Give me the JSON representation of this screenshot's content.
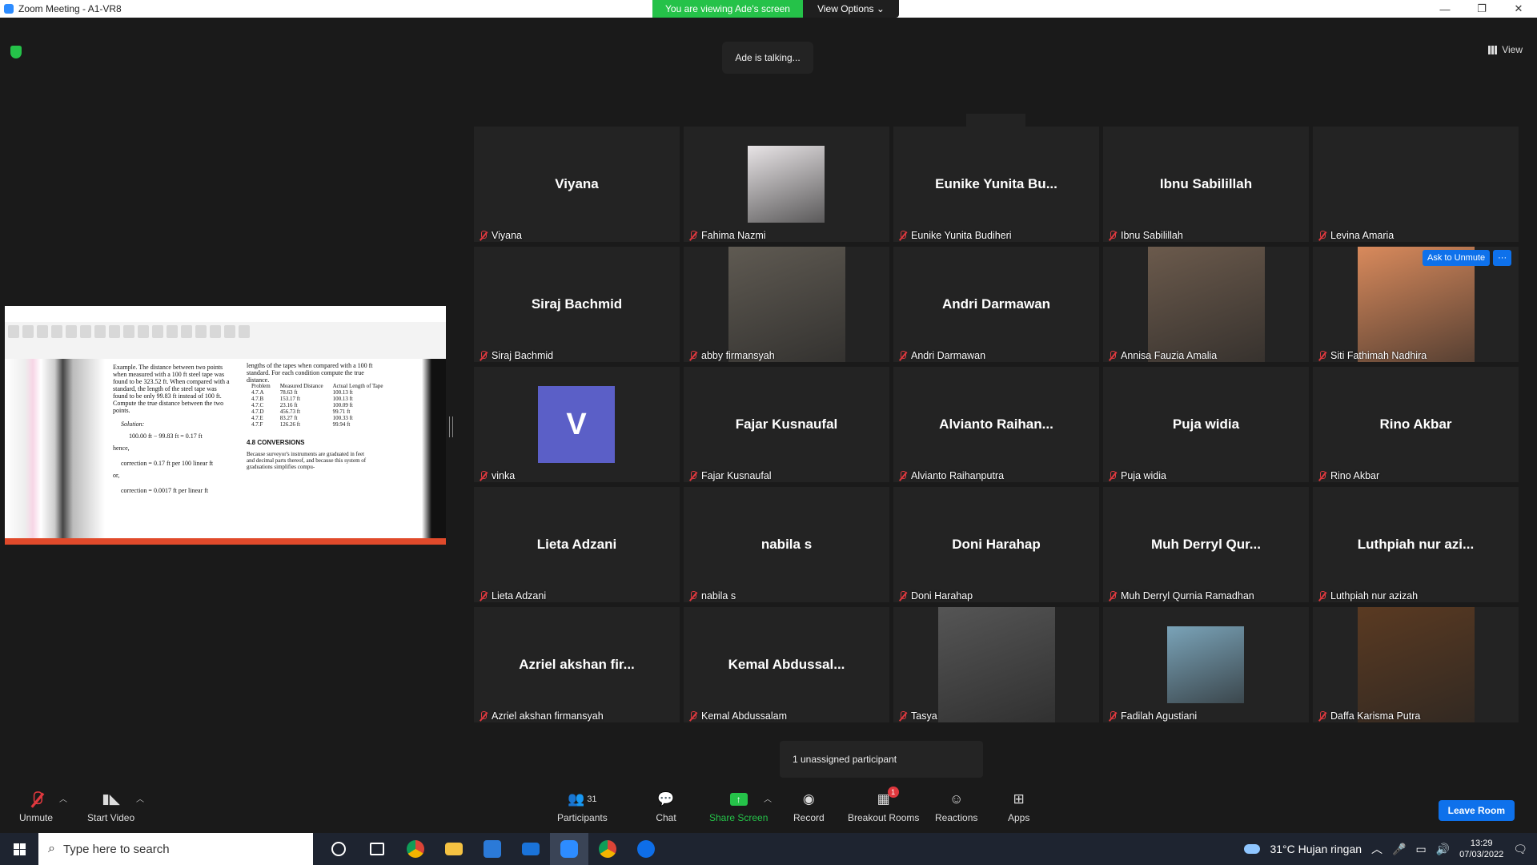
{
  "window": {
    "title": "Zoom Meeting - A1-VR8",
    "minimize": "—",
    "maximize": "❐",
    "close": "✕"
  },
  "banner": {
    "viewing": "You are viewing Ade's screen",
    "view_options": "View Options ⌄"
  },
  "talking": "Ade is talking...",
  "view_button": "View",
  "gallery_up": "︿",
  "shared_doc": {
    "para1": "Example. The distance between two points when measured with a 100 ft steel tape was found to be 323.52 ft. When compared with a standard, the length of the steel tape was found to be only 99.83 ft instead of 100 ft. Compute the true distance between the two points.",
    "solution": "Solution:",
    "calc": "100.00 ft − 99.83 ft = 0.17 ft",
    "hence": "hence,",
    "corr1": "correction = 0.17 ft per 100 linear ft",
    "or": "or,",
    "corr2": "correction = 0.0017 ft per linear ft",
    "right_text": "lengths of the tapes when compared with a 100 ft standard. For each condition compute the true distance.",
    "table_headers": [
      "Problem",
      "Measured Distance",
      "Actual Length of Tape"
    ],
    "table_rows": [
      [
        "4.7.A",
        "78.63 ft",
        "100.13 ft"
      ],
      [
        "4.7.B",
        "153.17 ft",
        "100.13 ft"
      ],
      [
        "4.7.C",
        "23.16 ft",
        "100.09 ft"
      ],
      [
        "4.7.D",
        "456.73 ft",
        "99.71 ft"
      ],
      [
        "4.7.E",
        "83.27 ft",
        "100.33 ft"
      ],
      [
        "4.7.F",
        "126.26 ft",
        "99.94 ft"
      ]
    ],
    "section": "4.8   CONVERSIONS",
    "section_text": "Because surveyor's instruments are graduated in feet and decimal parts thereof, and because this system of graduations simplifies compu-"
  },
  "participants": [
    {
      "display": "Viyana",
      "label": "Viyana",
      "pic": null
    },
    {
      "display": "",
      "label": "Fahima Nazmi",
      "pic": "small",
      "color": "#e8e4e6"
    },
    {
      "display": "Eunike Yunita Bu...",
      "label": "Eunike Yunita Budiheri",
      "pic": null
    },
    {
      "display": "Ibnu Sabilillah",
      "label": "Ibnu Sabilillah",
      "pic": null
    },
    {
      "display": "",
      "label": "Levina Amaria",
      "pic": null
    },
    {
      "display": "Siraj Bachmid",
      "label": "Siraj Bachmid",
      "pic": null
    },
    {
      "display": "",
      "label": "abby firmansyah",
      "pic": "full",
      "color": "#5f5a52"
    },
    {
      "display": "Andri Darmawan",
      "label": "Andri Darmawan",
      "pic": null
    },
    {
      "display": "",
      "label": "Annisa Fauzia Amalia",
      "pic": "full",
      "color": "#6b5a4c"
    },
    {
      "display": "",
      "label": "Siti Fathimah Nadhira",
      "pic": "full",
      "color": "#d98a5c"
    },
    {
      "display": "V",
      "label": "vinka",
      "pic": "letter",
      "color": "#5b5fc7"
    },
    {
      "display": "Fajar Kusnaufal",
      "label": "Fajar Kusnaufal",
      "pic": null
    },
    {
      "display": "Alvianto Raihan...",
      "label": "Alvianto Raihanputra",
      "pic": null
    },
    {
      "display": "Puja widia",
      "label": "Puja widia",
      "pic": null
    },
    {
      "display": "Rino Akbar",
      "label": "Rino Akbar",
      "pic": null
    },
    {
      "display": "Lieta Adzani",
      "label": "Lieta Adzani",
      "pic": null
    },
    {
      "display": "nabila s",
      "label": "nabila s",
      "pic": null
    },
    {
      "display": "Doni Harahap",
      "label": "Doni Harahap",
      "pic": null
    },
    {
      "display": "Muh Derryl Qur...",
      "label": "Muh Derryl Qurnia Ramadhan",
      "pic": null
    },
    {
      "display": "Luthpiah nur azi...",
      "label": "Luthpiah nur azizah",
      "pic": null
    },
    {
      "display": "Azriel akshan fir...",
      "label": "Azriel akshan firmansyah",
      "pic": null
    },
    {
      "display": "Kemal Abdussal...",
      "label": "Kemal Abdussalam",
      "pic": null
    },
    {
      "display": "",
      "label": "Tasya",
      "pic": "full",
      "color": "#555555"
    },
    {
      "display": "",
      "label": "Fadilah Agustiani",
      "pic": "small",
      "color": "#7aa3b8"
    },
    {
      "display": "",
      "label": "Daffa Karisma Putra",
      "pic": "full",
      "color": "#5a3a22"
    }
  ],
  "ask_unmute": {
    "label": "Ask to Unmute",
    "more": "···"
  },
  "unassigned": "1 unassigned participant",
  "toolbar": {
    "unmute": "Unmute",
    "start_video": "Start Video",
    "participants": "Participants",
    "participants_count": "31",
    "chat": "Chat",
    "share_screen": "Share Screen",
    "record": "Record",
    "breakout": "Breakout Rooms",
    "breakout_badge": "1",
    "reactions": "Reactions",
    "apps": "Apps",
    "leave": "Leave Room"
  },
  "taskbar": {
    "search_placeholder": "Type here to search",
    "weather": "31°C  Hujan ringan",
    "time": "13:29",
    "date": "07/03/2022"
  }
}
